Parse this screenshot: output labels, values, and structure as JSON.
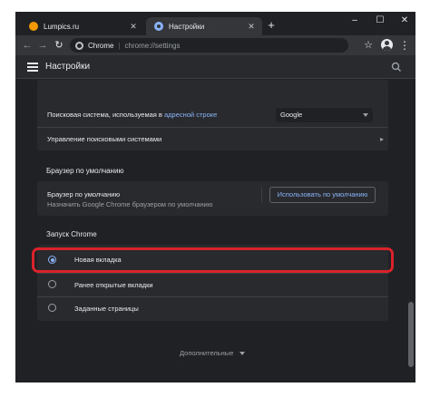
{
  "tabs": [
    {
      "label": "Lumpics.ru",
      "favicon": "lumpics-favicon-icon",
      "close": "✕"
    },
    {
      "label": "Настройки",
      "favicon": "settings-favicon-icon",
      "close": "✕"
    }
  ],
  "new_tab": "+",
  "window_controls": {
    "minimize": "–",
    "maximize": "☐",
    "close": "✕"
  },
  "toolbar": {
    "back": "←",
    "forward": "→",
    "reload": "↻",
    "omnibox_site": "Chrome",
    "omnibox_url": "chrome://settings",
    "star": "☆",
    "menu": "⋮"
  },
  "header": {
    "title": "Настройки"
  },
  "search_engine": {
    "label_prefix": "Поисковая система, используемая в ",
    "label_link": "адресной строке",
    "selected": "Google",
    "manage_label": "Управление поисковыми системами",
    "manage_chevron": "▸"
  },
  "default_browser": {
    "section_title": "Браузер по умолчанию",
    "label": "Браузер по умолчанию",
    "sublabel": "Назначить Google Chrome браузером по умолчанию",
    "button": "Использовать по умолчанию"
  },
  "startup": {
    "section_title": "Запуск Chrome",
    "options": [
      {
        "label": "Новая вкладка",
        "checked": true
      },
      {
        "label": "Ранее открытые вкладки",
        "checked": false
      },
      {
        "label": "Заданные страницы",
        "checked": false
      }
    ]
  },
  "advanced": {
    "label": "Дополнительные"
  },
  "colors": {
    "background": "#202124",
    "card": "#292a2d",
    "accent": "#8ab4f8",
    "highlight": "#d9222a"
  }
}
